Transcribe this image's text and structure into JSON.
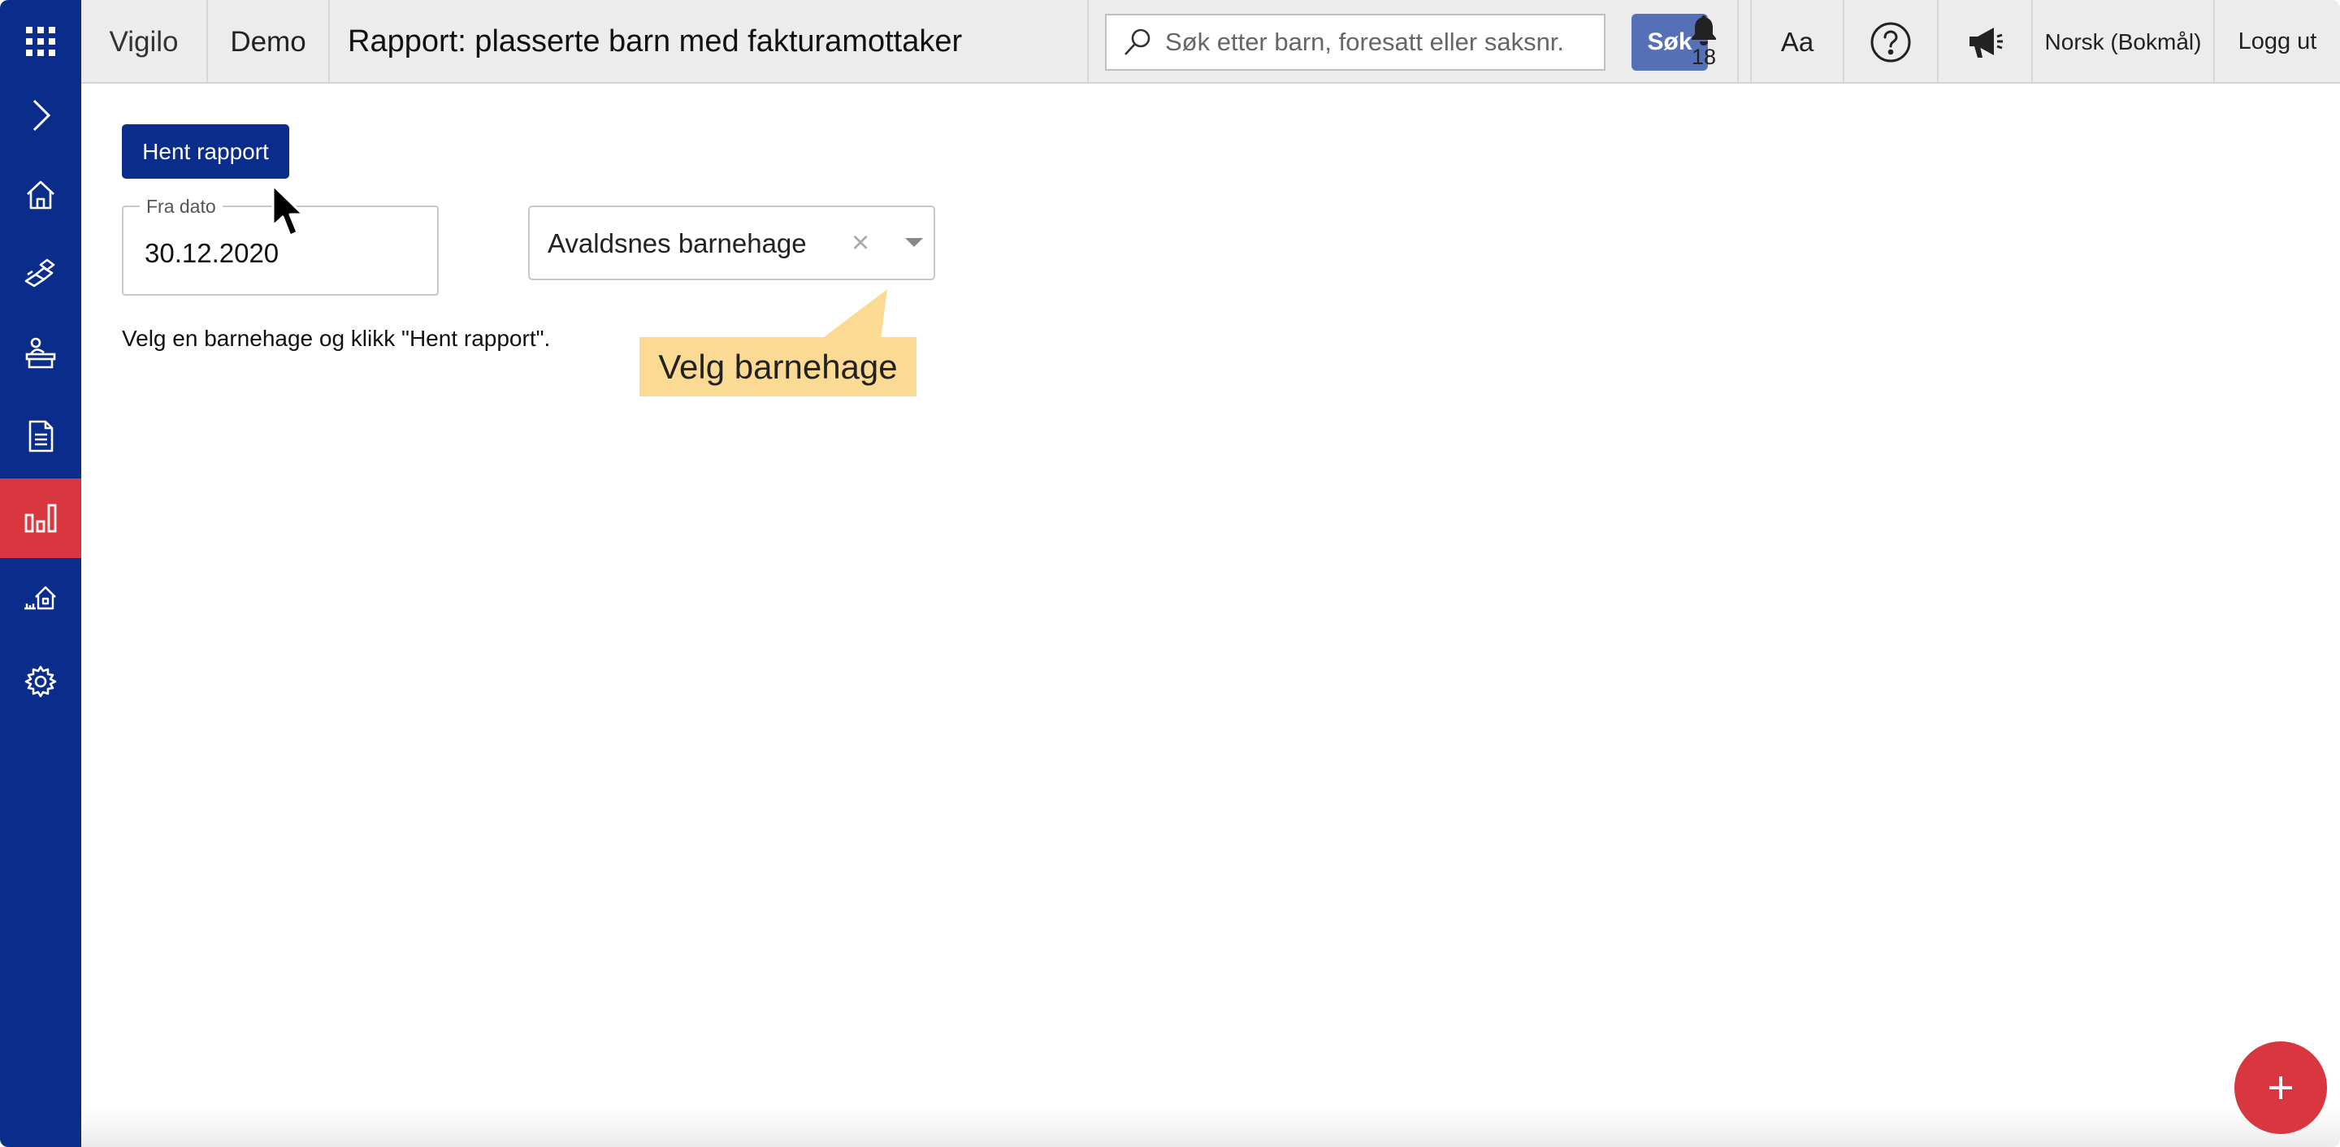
{
  "topbar": {
    "app_name": "Vigilo",
    "environment": "Demo",
    "page_title": "Rapport: plasserte barn med fakturamottaker",
    "search_placeholder": "Søk etter barn, foresatt eller saksnr.",
    "search_button": "Søk",
    "notification_count": "18",
    "font_size_label": "Aa",
    "language": "Norsk (Bokmål)",
    "logout": "Logg ut"
  },
  "sidebar": {
    "items": [
      {
        "icon": "apps-grid-icon"
      },
      {
        "icon": "expand-chevron-icon"
      },
      {
        "icon": "home-icon"
      },
      {
        "icon": "blocks-icon"
      },
      {
        "icon": "person-desk-icon"
      },
      {
        "icon": "document-icon"
      },
      {
        "icon": "bar-chart-icon",
        "active": true
      },
      {
        "icon": "kindergarten-icon"
      },
      {
        "icon": "settings-gear-icon"
      }
    ],
    "active_color": "#d8373f",
    "background_color": "#0a2d8c"
  },
  "main": {
    "fetch_button": "Hent rapport",
    "date_label": "Fra dato",
    "date_value": "30.12.2020",
    "kindergarten_selected": "Avaldsnes barnehage",
    "clear_symbol": "×",
    "hint": "Velg en barnehage og klikk \"Hent rapport\".",
    "callout": "Velg barnehage",
    "fab_symbol": "+"
  }
}
